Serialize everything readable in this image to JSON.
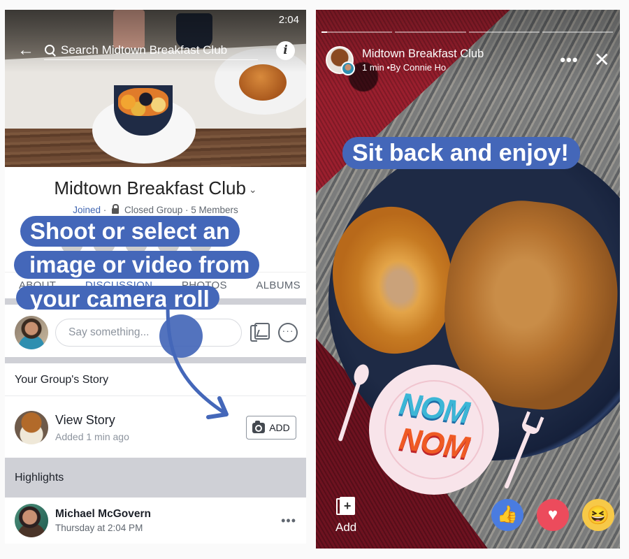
{
  "left_screen": {
    "status_time": "2:04",
    "search": {
      "back_icon": "←",
      "placeholder": "Search Midtown Breakfast Club",
      "info_icon": "i"
    },
    "group": {
      "title": "Midtown Breakfast Club",
      "title_chevron": "⌄",
      "joined": "Joined",
      "separator": " · ",
      "privacy": "Closed Group",
      "members": "5 Members"
    },
    "tabs": [
      {
        "label": "ABOUT",
        "active": false
      },
      {
        "label": "DISCUSSION",
        "active": true
      },
      {
        "label": "PHOTOS",
        "active": false
      },
      {
        "label": "ALBUMS",
        "active": false
      }
    ],
    "composer": {
      "placeholder": "Say something...",
      "more_icon": "···"
    },
    "story_section": {
      "header": "Your Group's Story",
      "title": "View Story",
      "subtitle": "Added 1 min ago",
      "add_button": "ADD"
    },
    "highlights": {
      "header": "Highlights",
      "post_author": "Michael McGovern",
      "post_time": "Thursday at 2:04 PM",
      "more_icon": "•••"
    },
    "callout": {
      "line1": "Shoot or select an",
      "line2": "image or video from",
      "line3": "your camera roll"
    }
  },
  "right_screen": {
    "progress_segments": [
      {
        "fill_percent": 8
      },
      {
        "fill_percent": 0
      },
      {
        "fill_percent": 0
      },
      {
        "fill_percent": 0
      }
    ],
    "group_name": "Midtown Breakfast Club",
    "byline": "1 min •By Connie Ho",
    "more_icon": "•••",
    "close_icon": "✕",
    "caption": "Sit back and enjoy!",
    "sticker": {
      "line1": "NOM",
      "line2": "NOM"
    },
    "add_label": "Add",
    "add_icon": "+",
    "reactions": [
      {
        "name": "like",
        "glyph": "👍"
      },
      {
        "name": "love",
        "glyph": "♥"
      },
      {
        "name": "haha",
        "glyph": "😆"
      }
    ]
  },
  "colors": {
    "brand_blue": "#4267b2",
    "callout_blue": "#4467b9",
    "divider_gray": "#cfd0d6",
    "like_blue": "#4a7ce0",
    "love_red": "#ec4b5c",
    "haha_yellow": "#f7c948"
  }
}
